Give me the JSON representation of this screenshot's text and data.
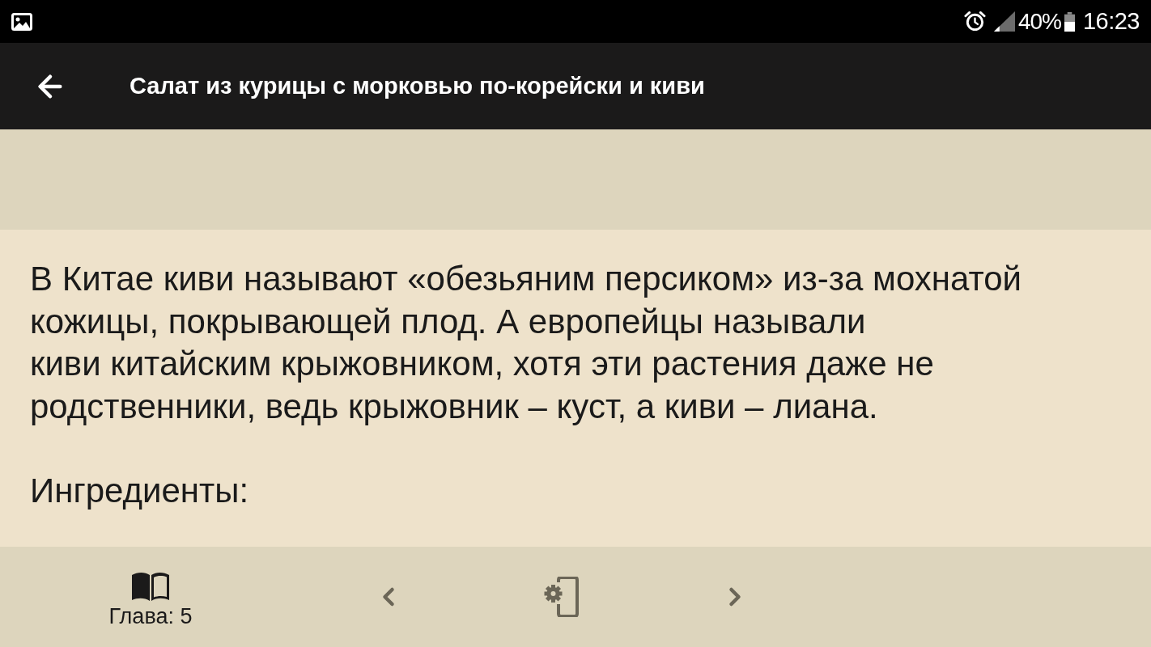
{
  "status_bar": {
    "battery": "40%",
    "time": "16:23"
  },
  "app_bar": {
    "title": "Салат из курицы с морковью по-корейски и киви"
  },
  "content": {
    "paragraphs": [
      "В Китае киви называют «обезьяним персиком» из-за мохнатой кожицы, покрывающей плод. А европейцы называли\nкиви китайским крыжовником, хотя эти растения даже не родственники, ведь крыжовник – куст, а киви – лиана.",
      "Ингредиенты:"
    ]
  },
  "bottom_bar": {
    "chapter": "Глава: 5"
  }
}
